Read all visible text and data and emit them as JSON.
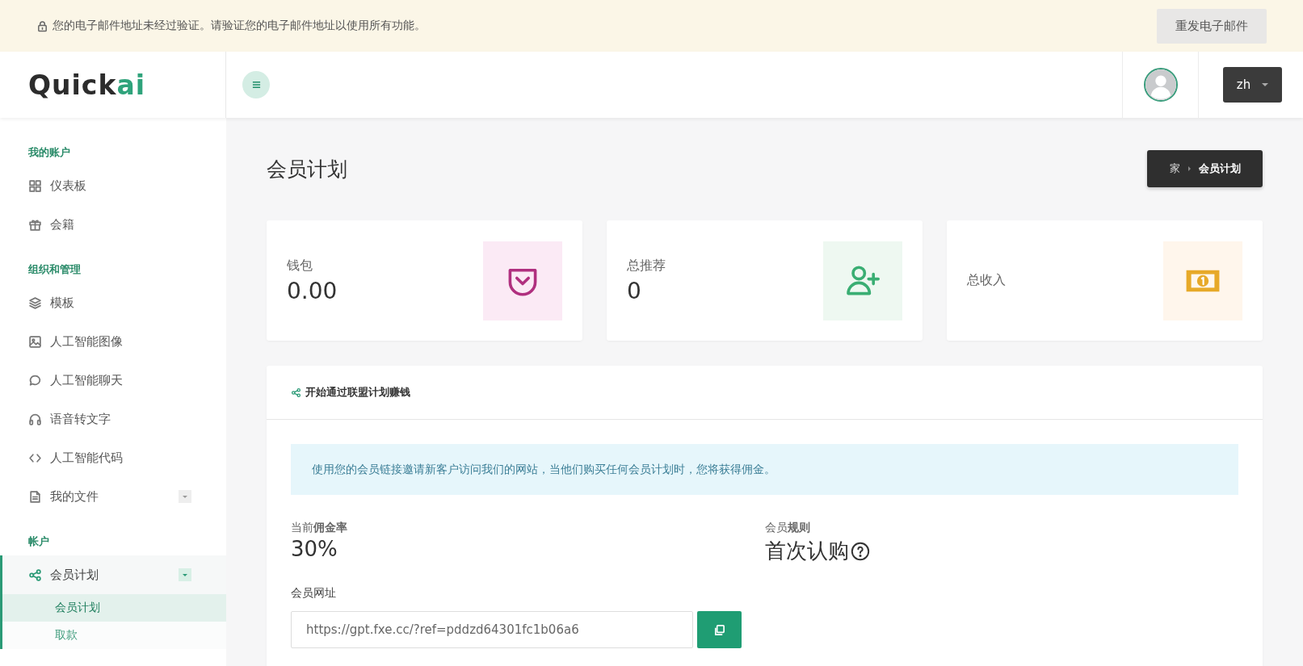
{
  "notice": {
    "text": "您的电子邮件地址未经过验证。请验证您的电子邮件地址以使用所有功能。",
    "button": "重发电子邮件"
  },
  "header": {
    "logo": {
      "main": "Quick",
      "accent": "ai"
    },
    "language": "zh"
  },
  "sidebar": {
    "sections": [
      {
        "title": "我的账户",
        "items": [
          {
            "label": "仪表板",
            "selected": false
          },
          {
            "label": "会籍",
            "selected": false
          }
        ]
      },
      {
        "title": "组织和管理",
        "items": [
          {
            "label": "模板",
            "selected": false
          },
          {
            "label": "人工智能图像",
            "selected": false
          },
          {
            "label": "人工智能聊天",
            "selected": false
          },
          {
            "label": "语音转文字",
            "selected": false
          },
          {
            "label": "人工智能代码",
            "selected": false
          },
          {
            "label": "我的文件",
            "selected": false,
            "expanded": false
          }
        ]
      },
      {
        "title": "帐户",
        "items": [
          {
            "label": "会员计划",
            "selected": true,
            "expanded": true,
            "children": [
              {
                "label": "会员计划",
                "selected": true
              },
              {
                "label": "取款",
                "selected": false
              }
            ]
          }
        ]
      }
    ]
  },
  "page": {
    "title": "会员计划",
    "breadcrumb": [
      {
        "label": "家",
        "current": false
      },
      {
        "label": "会员计划",
        "current": true
      }
    ]
  },
  "stats": [
    {
      "label": "钱包",
      "value": "0.00"
    },
    {
      "label": "总推荐",
      "value": "0"
    },
    {
      "label": "总收入"
    }
  ],
  "affiliate": {
    "title": "开始通过联盟计划赚钱",
    "info": "使用您的会员链接邀请新客户访问我们的网站，当他们购买任何会员计划时，您将获得佣金。",
    "rate_label": "当前**佣金率**",
    "rate": "30%",
    "rule_label": "会员**规则**",
    "rule": "首次认购",
    "url_label": "会员网址",
    "url": "https://gpt.fxe.cc/?ref=pddzd64301fc1b06a6"
  }
}
